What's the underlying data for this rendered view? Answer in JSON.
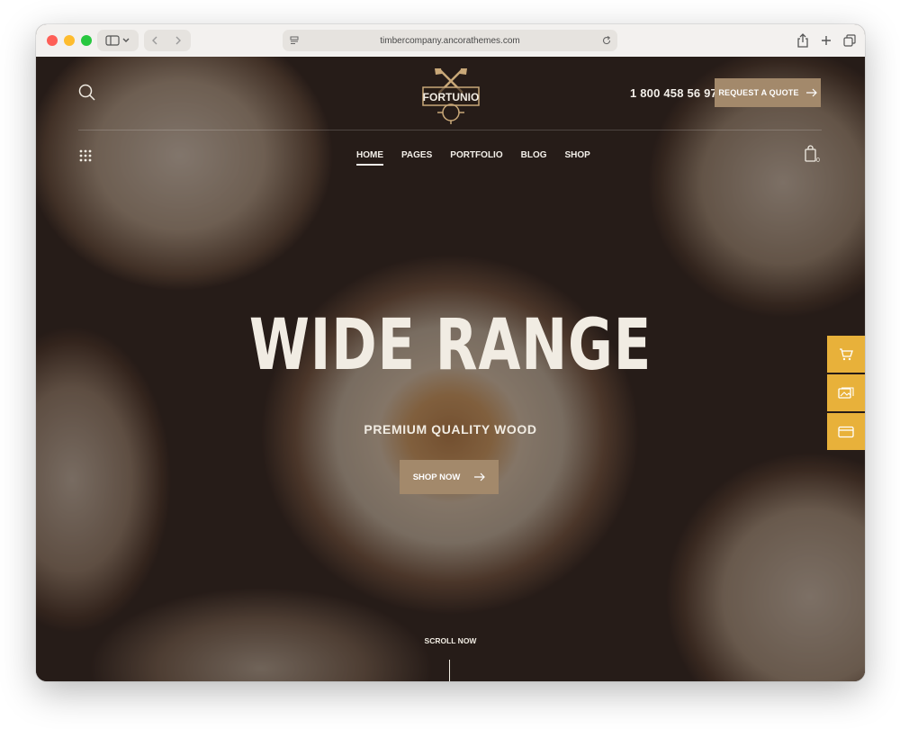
{
  "browser": {
    "url": "timbercompany.ancorathemes.com"
  },
  "site": {
    "logo_text": "FORTUNIO",
    "phone": "1 800 458 56 97",
    "quote_button": "REQUEST A QUOTE",
    "nav": [
      "HOME",
      "PAGES",
      "PORTFOLIO",
      "BLOG",
      "SHOP"
    ],
    "active_nav": "HOME",
    "cart_count": "0"
  },
  "hero": {
    "headline": "WIDE RANGE",
    "subline": "PREMIUM QUALITY WOOD",
    "cta": "SHOP NOW",
    "scroll": "SCROLL NOW"
  },
  "dock": {
    "icons": [
      "cart-icon",
      "image-icon",
      "card-icon"
    ]
  },
  "colors": {
    "accent": "#a3896b",
    "dock": "#e8b13a",
    "text": "#f1ece3"
  }
}
